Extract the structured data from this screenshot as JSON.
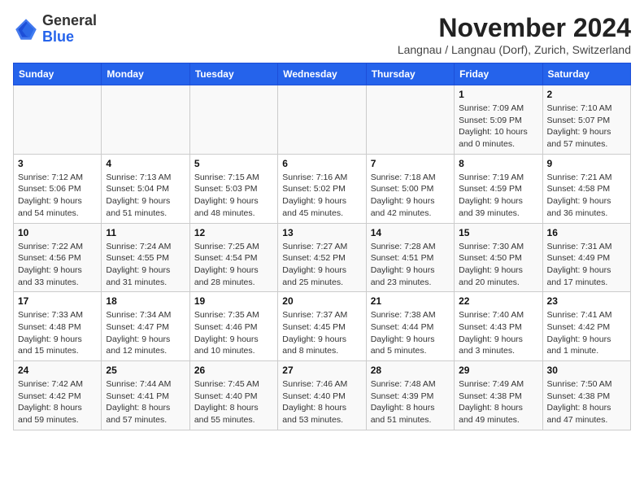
{
  "header": {
    "logo_general": "General",
    "logo_blue": "Blue",
    "month_title": "November 2024",
    "location": "Langnau / Langnau (Dorf), Zurich, Switzerland"
  },
  "days_of_week": [
    "Sunday",
    "Monday",
    "Tuesday",
    "Wednesday",
    "Thursday",
    "Friday",
    "Saturday"
  ],
  "weeks": [
    [
      {
        "day": "",
        "info": ""
      },
      {
        "day": "",
        "info": ""
      },
      {
        "day": "",
        "info": ""
      },
      {
        "day": "",
        "info": ""
      },
      {
        "day": "",
        "info": ""
      },
      {
        "day": "1",
        "info": "Sunrise: 7:09 AM\nSunset: 5:09 PM\nDaylight: 10 hours and 0 minutes."
      },
      {
        "day": "2",
        "info": "Sunrise: 7:10 AM\nSunset: 5:07 PM\nDaylight: 9 hours and 57 minutes."
      }
    ],
    [
      {
        "day": "3",
        "info": "Sunrise: 7:12 AM\nSunset: 5:06 PM\nDaylight: 9 hours and 54 minutes."
      },
      {
        "day": "4",
        "info": "Sunrise: 7:13 AM\nSunset: 5:04 PM\nDaylight: 9 hours and 51 minutes."
      },
      {
        "day": "5",
        "info": "Sunrise: 7:15 AM\nSunset: 5:03 PM\nDaylight: 9 hours and 48 minutes."
      },
      {
        "day": "6",
        "info": "Sunrise: 7:16 AM\nSunset: 5:02 PM\nDaylight: 9 hours and 45 minutes."
      },
      {
        "day": "7",
        "info": "Sunrise: 7:18 AM\nSunset: 5:00 PM\nDaylight: 9 hours and 42 minutes."
      },
      {
        "day": "8",
        "info": "Sunrise: 7:19 AM\nSunset: 4:59 PM\nDaylight: 9 hours and 39 minutes."
      },
      {
        "day": "9",
        "info": "Sunrise: 7:21 AM\nSunset: 4:58 PM\nDaylight: 9 hours and 36 minutes."
      }
    ],
    [
      {
        "day": "10",
        "info": "Sunrise: 7:22 AM\nSunset: 4:56 PM\nDaylight: 9 hours and 33 minutes."
      },
      {
        "day": "11",
        "info": "Sunrise: 7:24 AM\nSunset: 4:55 PM\nDaylight: 9 hours and 31 minutes."
      },
      {
        "day": "12",
        "info": "Sunrise: 7:25 AM\nSunset: 4:54 PM\nDaylight: 9 hours and 28 minutes."
      },
      {
        "day": "13",
        "info": "Sunrise: 7:27 AM\nSunset: 4:52 PM\nDaylight: 9 hours and 25 minutes."
      },
      {
        "day": "14",
        "info": "Sunrise: 7:28 AM\nSunset: 4:51 PM\nDaylight: 9 hours and 23 minutes."
      },
      {
        "day": "15",
        "info": "Sunrise: 7:30 AM\nSunset: 4:50 PM\nDaylight: 9 hours and 20 minutes."
      },
      {
        "day": "16",
        "info": "Sunrise: 7:31 AM\nSunset: 4:49 PM\nDaylight: 9 hours and 17 minutes."
      }
    ],
    [
      {
        "day": "17",
        "info": "Sunrise: 7:33 AM\nSunset: 4:48 PM\nDaylight: 9 hours and 15 minutes."
      },
      {
        "day": "18",
        "info": "Sunrise: 7:34 AM\nSunset: 4:47 PM\nDaylight: 9 hours and 12 minutes."
      },
      {
        "day": "19",
        "info": "Sunrise: 7:35 AM\nSunset: 4:46 PM\nDaylight: 9 hours and 10 minutes."
      },
      {
        "day": "20",
        "info": "Sunrise: 7:37 AM\nSunset: 4:45 PM\nDaylight: 9 hours and 8 minutes."
      },
      {
        "day": "21",
        "info": "Sunrise: 7:38 AM\nSunset: 4:44 PM\nDaylight: 9 hours and 5 minutes."
      },
      {
        "day": "22",
        "info": "Sunrise: 7:40 AM\nSunset: 4:43 PM\nDaylight: 9 hours and 3 minutes."
      },
      {
        "day": "23",
        "info": "Sunrise: 7:41 AM\nSunset: 4:42 PM\nDaylight: 9 hours and 1 minute."
      }
    ],
    [
      {
        "day": "24",
        "info": "Sunrise: 7:42 AM\nSunset: 4:42 PM\nDaylight: 8 hours and 59 minutes."
      },
      {
        "day": "25",
        "info": "Sunrise: 7:44 AM\nSunset: 4:41 PM\nDaylight: 8 hours and 57 minutes."
      },
      {
        "day": "26",
        "info": "Sunrise: 7:45 AM\nSunset: 4:40 PM\nDaylight: 8 hours and 55 minutes."
      },
      {
        "day": "27",
        "info": "Sunrise: 7:46 AM\nSunset: 4:40 PM\nDaylight: 8 hours and 53 minutes."
      },
      {
        "day": "28",
        "info": "Sunrise: 7:48 AM\nSunset: 4:39 PM\nDaylight: 8 hours and 51 minutes."
      },
      {
        "day": "29",
        "info": "Sunrise: 7:49 AM\nSunset: 4:38 PM\nDaylight: 8 hours and 49 minutes."
      },
      {
        "day": "30",
        "info": "Sunrise: 7:50 AM\nSunset: 4:38 PM\nDaylight: 8 hours and 47 minutes."
      }
    ]
  ]
}
